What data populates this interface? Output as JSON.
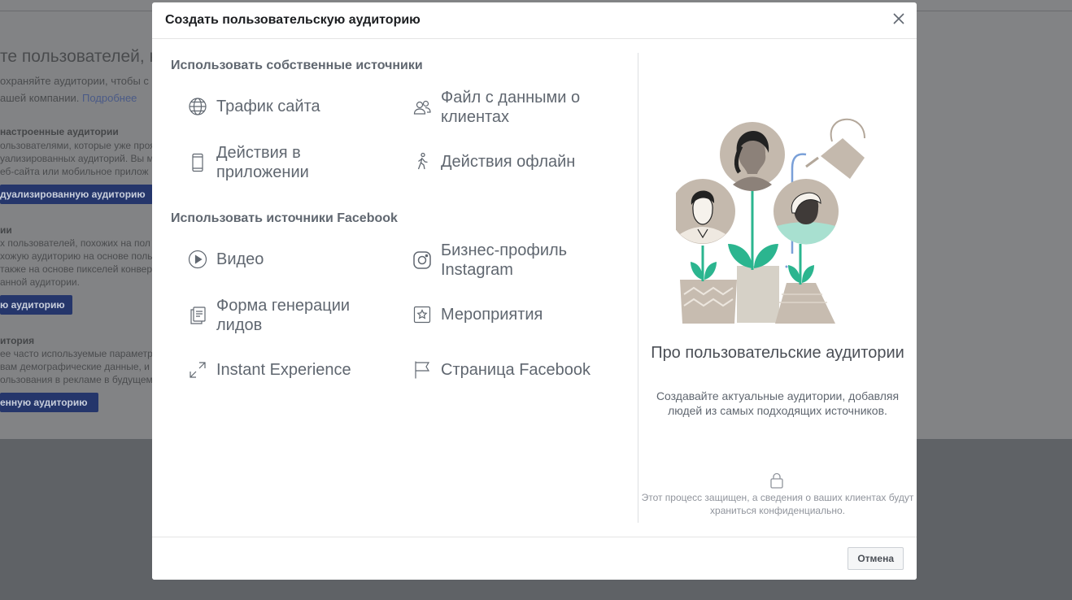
{
  "background": {
    "heading": "те пользователей, ко",
    "intro_line1": "охраняйте аудитории, чтобы с",
    "intro_line2": "ашей компании.",
    "intro_link": "Подробнее",
    "section1_title": "настроенные аудитории",
    "section1_lines": [
      "ользователями, которые уже прояв",
      "уализированных аудиторий. Вы м",
      "еб-сайта или мобильное прилож"
    ],
    "section1_button": "дуализированную аудиторию",
    "section2_title": "ии",
    "section2_lines": [
      "х пользователей, похожих на пол",
      "хожую аудиторию на основе поль",
      "также на основе пикселей конвер",
      "анной аудитории."
    ],
    "section2_button": "ю аудиторию",
    "section3_title": "итория",
    "section3_lines": [
      "ее часто используемые параметр",
      "вам демографические данные, и",
      "ользования в рекламе в будущем"
    ],
    "section3_button": "енную аудиторию"
  },
  "modal": {
    "title": "Создать пользовательскую аудиторию",
    "own_sources_title": "Использовать собственные источники",
    "own_sources": [
      {
        "label": "Трафик сайта",
        "icon": "globe-icon"
      },
      {
        "label": "Файл с данными о клиентах",
        "icon": "people-icon"
      },
      {
        "label": "Действия в приложении",
        "icon": "mobile-phone-icon"
      },
      {
        "label": "Действия офлайн",
        "icon": "walking-person-icon"
      }
    ],
    "facebook_sources_title": "Использовать источники Facebook",
    "facebook_sources": [
      {
        "label": "Видео",
        "icon": "play-icon"
      },
      {
        "label": "Бизнес-профиль Instagram",
        "icon": "instagram-icon"
      },
      {
        "label": "Форма генерации лидов",
        "icon": "lead-form-icon"
      },
      {
        "label": "Мероприятия",
        "icon": "event-star-icon"
      },
      {
        "label": "Instant Experience",
        "icon": "expand-arrows-icon"
      },
      {
        "label": "Страница Facebook",
        "icon": "flag-icon"
      }
    ],
    "about_title": "Про пользовательские аудитории",
    "about_description": "Создавайте актуальные аудитории, добавляя людей из самых подходящих источников.",
    "privacy_note": "Этот процесс защищен, а сведения о ваших клиентах будут храниться конфиденциально.",
    "cancel_label": "Отмена"
  },
  "colors": {
    "overlay": "#5f6266",
    "icon_gray": "#606770",
    "teal": "#2bb58f",
    "beige": "#d6d1c7",
    "brown": "#b3a79a"
  }
}
